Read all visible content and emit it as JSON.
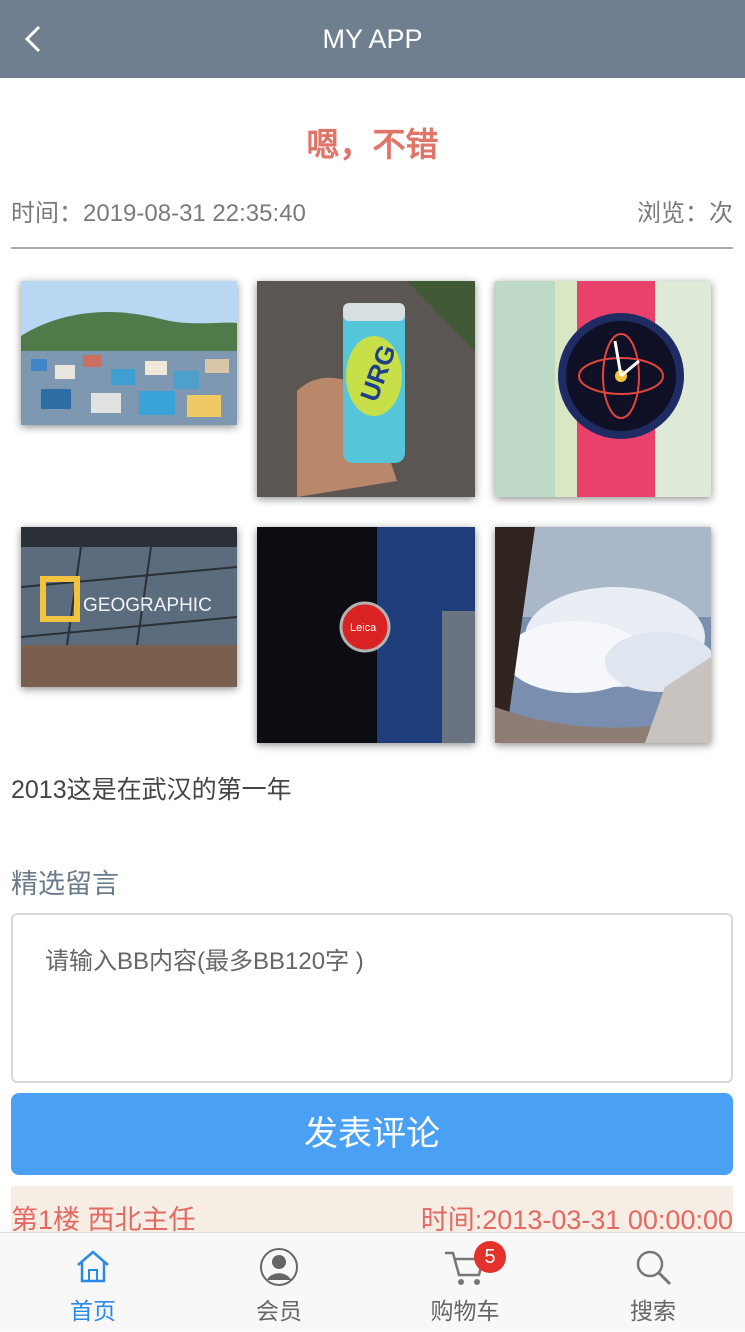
{
  "header": {
    "title": "MY APP",
    "back_icon": "chevron-left-icon"
  },
  "article": {
    "title": "嗯，不错",
    "time": "时间：2019-08-31 22:35:40",
    "views": "浏览：次",
    "caption": "2013这是在武汉的第一年"
  },
  "gallery": {
    "images": [
      "town-hillside-photo",
      "pineapple-can-photo",
      "watch-on-map-photo",
      "national-geographic-building-photo",
      "leica-sign-photo",
      "clouds-window-photo"
    ]
  },
  "comments": {
    "section_title": "精选留言",
    "placeholder": "请输入BB内容(最多BB120字 )",
    "submit_label": "发表评论",
    "items": [
      {
        "floor": "第1楼  西北主任",
        "time": "时间:2013-03-31 00:00:00"
      }
    ]
  },
  "tabbar": {
    "items": [
      {
        "label": "首页",
        "icon": "home-icon",
        "active": true
      },
      {
        "label": "会员",
        "icon": "user-icon",
        "active": false
      },
      {
        "label": "购物车",
        "icon": "cart-icon",
        "active": false,
        "badge": "5"
      },
      {
        "label": "搜索",
        "icon": "search-icon",
        "active": false
      }
    ]
  },
  "colors": {
    "header": "#6f7f90",
    "accent_red": "#e07468",
    "button_blue": "#4aa0f5",
    "active_tab": "#2a8ae8"
  }
}
